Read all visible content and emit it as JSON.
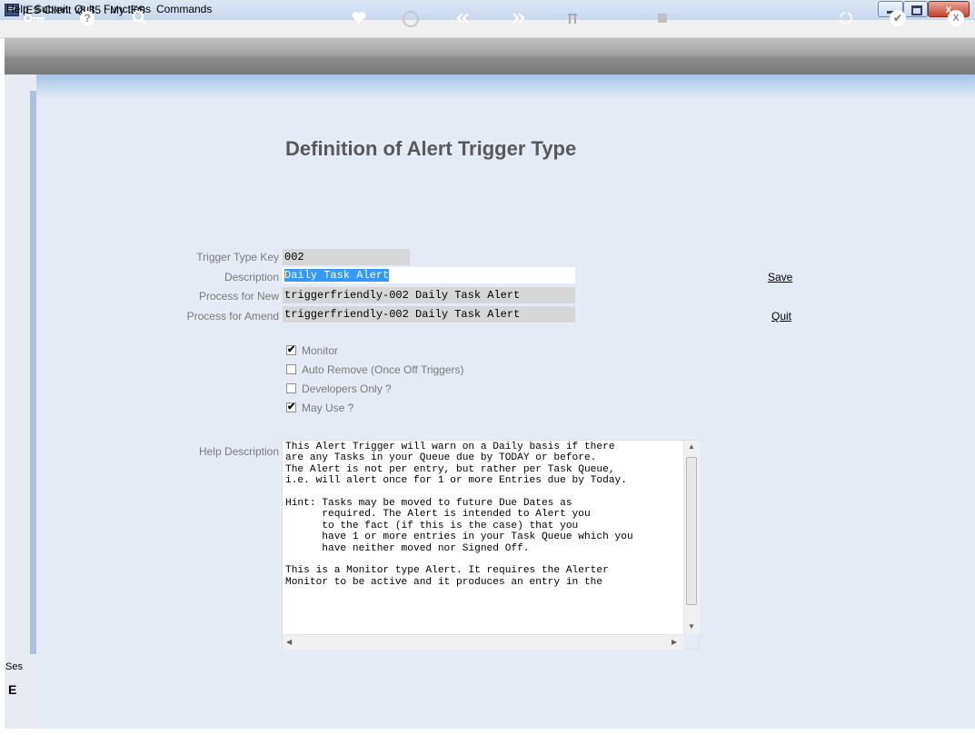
{
  "window": {
    "title": "IES Client v8.35 : My IES",
    "close_glyph": "x"
  },
  "menu": [
    "Help",
    "Submit",
    "Quit",
    "Functions",
    "Commands"
  ],
  "toolbar": {
    "icons": [
      "key-icon",
      "help-icon",
      "search-icon",
      "heart-icon",
      "clock-icon",
      "rewind-icon",
      "fast-forward-icon",
      "tree-icon",
      "stop-icon",
      "recycle-icon",
      "check-icon",
      "close-icon"
    ],
    "help_glyph": "?",
    "close_glyph": "X",
    "check_glyph": "✔"
  },
  "session": {
    "label": "Ses",
    "glyph": "E"
  },
  "page": {
    "title": "Definition of Alert Trigger Type"
  },
  "form": {
    "trigger_type_key_label": "Trigger Type Key",
    "trigger_type_key_value": "002",
    "description_label": "Description",
    "description_value": "Daily Task Alert",
    "process_new_label": "Process for New",
    "process_new_value": "triggerfriendly-002 Daily Task Alert",
    "process_amend_label": "Process for Amend",
    "process_amend_value": "triggerfriendly-002 Daily Task Alert",
    "help_description_label": "Help Description",
    "help_description_value": "This Alert Trigger will warn on a Daily basis if there\nare any Tasks in your Queue due by TODAY or before.\nThe Alert is not per entry, but rather per Task Queue,\ni.e. will alert once for 1 or more Entries due by Today.\n\nHint: Tasks may be moved to future Due Dates as\n      required. The Alert is intended to Alert you\n      to the fact (if this is the case) that you\n      have 1 or more entries in your Task Queue which you\n      have neither moved nor Signed Off.\n\nThis is a Monitor type Alert. It requires the Alerter\nMonitor to be active and it produces an entry in the"
  },
  "checkboxes": [
    {
      "label": "Monitor",
      "checked": true
    },
    {
      "label": "Auto Remove (Once Off Triggers)",
      "checked": false
    },
    {
      "label": "Developers Only ?",
      "checked": false
    },
    {
      "label": "May Use ?",
      "checked": true
    }
  ],
  "check_glyph": "✔",
  "actions": {
    "save_label": "Save",
    "quit_label": "Quit"
  }
}
